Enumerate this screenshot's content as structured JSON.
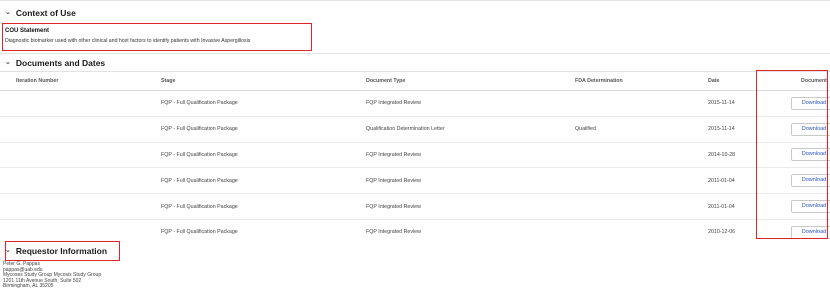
{
  "context": {
    "header": "Context of Use",
    "cou_title": "COU Statement",
    "cou_text": "Diagnostic biomarker used with other clinical and host factors to identify patients with Invasive Aspergillosis"
  },
  "documents": {
    "header": "Documents and Dates",
    "columns": [
      "Iteration Number",
      "Stage",
      "Document Type",
      "FDA Determination",
      "Date",
      "Document"
    ],
    "download_label": "Download",
    "rows": [
      {
        "iteration": "",
        "stage": "FQP - Full Qualification Package",
        "type": "FQP Integrated Review",
        "fda": "",
        "date": "2015-11-14"
      },
      {
        "iteration": "",
        "stage": "FQP - Full Qualification Package",
        "type": "Qualification Determination Letter",
        "fda": "Qualified",
        "date": "2015-11-14"
      },
      {
        "iteration": "",
        "stage": "FQP - Full Qualification Package",
        "type": "FQP Integrated Review",
        "fda": "",
        "date": "2014-10-28"
      },
      {
        "iteration": "",
        "stage": "FQP - Full Qualification Package",
        "type": "FQP Integrated Review",
        "fda": "",
        "date": "2011-01-04"
      },
      {
        "iteration": "",
        "stage": "FQP - Full Qualification Package",
        "type": "FQP Integrated Review",
        "fda": "",
        "date": "2011-01-04"
      },
      {
        "iteration": "",
        "stage": "FQP - Full Qualification Package",
        "type": "FQP Integrated Review",
        "fda": "",
        "date": "2010-12-06"
      }
    ]
  },
  "requestor": {
    "header": "Requestor Information",
    "lines": [
      "Peter G. Pappas",
      "pappas@uab.edu",
      "Mycoses Study Group Mycosis Study Group",
      "1201 11th Avenue South, Suite 502",
      "Birmingham, AL 35205"
    ]
  },
  "colors": {
    "highlight": "#e0242a",
    "link": "#2a56c6"
  }
}
